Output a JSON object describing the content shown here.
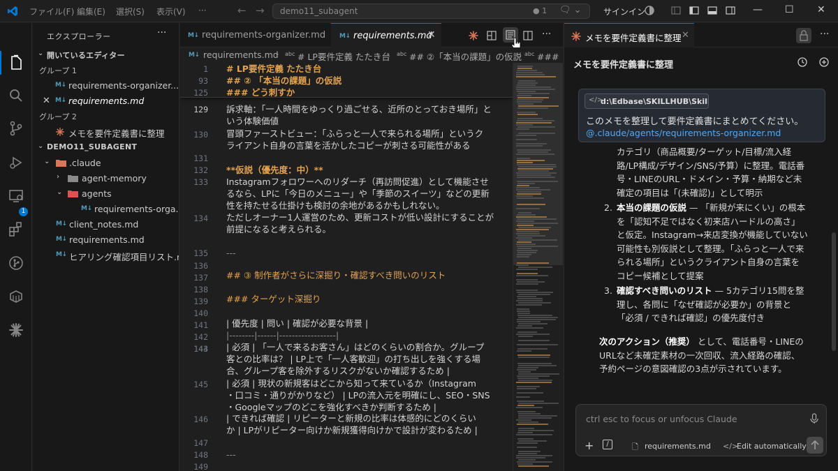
{
  "titlebar": {
    "menus": [
      "ファイル(F)",
      "編集(E)",
      "選択(S)",
      "表示(V)",
      "···"
    ],
    "search_text": "demo11_subagent",
    "notification_count": "1",
    "signin_label": "サインイン"
  },
  "activitybar": {
    "extensions_badge": "1"
  },
  "explorer": {
    "title": "エクスプローラー",
    "more": "···",
    "open_editors_label": "開いているエディター",
    "group1_label": "グループ 1",
    "group1_items": [
      "requirements-organizer....",
      "requirements.md"
    ],
    "group2_label": "グループ 2",
    "group2_items": [
      "メモを要件定義書に整理"
    ],
    "workspace_label": "DEMO11_SUBAGENT",
    "tree": {
      "claude_folder": ".claude",
      "agent_memory": "agent-memory",
      "agents": "agents",
      "agents_file": "requirements-orga...",
      "files": [
        "client_notes.md",
        "requirements.md",
        "ヒアリング確認項目リスト.md"
      ]
    }
  },
  "editor": {
    "tabs": [
      {
        "label": "requirements-organizer.md",
        "active": false
      },
      {
        "label": "requirements.md",
        "active": true
      }
    ],
    "close_glyph": "✕",
    "breadcrumb": [
      "requirements.md",
      "# LP要件定義 たたき台",
      "## ②「本当の課題」の仮説",
      "### ど"
    ],
    "sticky": [
      {
        "ln": "1",
        "text": "# LP要件定義 たたき台"
      },
      {
        "ln": "93",
        "text": "## ② 「本当の課題」の仮説"
      },
      {
        "ln": "125",
        "text": "### どう刺すか"
      }
    ],
    "lines": [
      {
        "ln": "129",
        "text": "訴求軸：「一人時間をゆっくり過ごせる、近所のとっておき場所」と"
      },
      {
        "ln": "",
        "text": "いう体験価値"
      },
      {
        "ln": "130",
        "text": "冒頭ファーストビュー：「ふらっと一人で来られる場所」というク"
      },
      {
        "ln": "",
        "text": "ライアント自身の言葉を活かしたコピーが刺さる可能性がある"
      },
      {
        "ln": "131",
        "text": ""
      },
      {
        "ln": "132",
        "text": "**仮説（優先度：中）**"
      },
      {
        "ln": "133",
        "text": "Instagramフォロワーへのリダーチ（再訪問促進）として機能させ"
      },
      {
        "ln": "",
        "text": "るなら、LPに「今日のメニュー」や「季節のスイーツ」などの更新"
      },
      {
        "ln": "",
        "text": "性を持たせる仕掛けも検討の余地があるかもしれない。"
      },
      {
        "ln": "134",
        "text": "ただしオーナー1人運営のため、更新コストが低い設計にすることが"
      },
      {
        "ln": "",
        "text": "前提になると考えられる。"
      },
      {
        "ln": "135",
        "text": ""
      },
      {
        "ln": "136",
        "text": "---"
      },
      {
        "ln": "137",
        "text": ""
      },
      {
        "ln": "138",
        "text": "## ③ 制作者がさらに深掘り・確認すべき問いのリスト"
      },
      {
        "ln": "139",
        "text": ""
      },
      {
        "ln": "140",
        "text": "### ターゲット深掘り"
      },
      {
        "ln": "141",
        "text": ""
      },
      {
        "ln": "142",
        "text": "| 優先度 | 問い | 確認が必要な背景 |"
      },
      {
        "ln": "143",
        "text": "|--------|------|------------------|"
      },
      {
        "ln": "144",
        "text": "| 必須 | 「一人で来るお客さん」はどのくらいの割合か。グループ"
      },
      {
        "ln": "",
        "text": "客との比率は？ | LP上で「一人客歓迎」の打ち出しを強くする場"
      },
      {
        "ln": "",
        "text": "合、グループ客を除外するリスクがないか確認するため |"
      },
      {
        "ln": "145",
        "text": "| 必須 | 現状の新規客はどこから知って来ているか（Instagram"
      },
      {
        "ln": "",
        "text": "・口コミ・通りがかりなど） | LPの流入元を明確にし、SEO・SNS"
      },
      {
        "ln": "",
        "text": "・Googleマップのどこを強化すべきか判断するため |"
      },
      {
        "ln": "146",
        "text": "| できれば確認 | リピーターと新規の比率は体感的にどのくらい"
      },
      {
        "ln": "",
        "text": "か | LPがリピーター向けか新規獲得向けかで設計が変わるため |"
      },
      {
        "ln": "147",
        "text": ""
      },
      {
        "ln": "148",
        "text": "---"
      },
      {
        "ln": "149",
        "text": ""
      }
    ]
  },
  "claude": {
    "tab_label": "メモを要件定義書に整理",
    "header_title": "メモを要件定義書に整理",
    "user_message": {
      "file_chip": "d:\\Edbase\\SKILLHUB\\Skillhu...",
      "text": "このメモを整理して要件定義書にまとめてください。",
      "mention": "@.claude/agents/requirements-organizer.md"
    },
    "response": {
      "item1_lines": [
        "カテゴリ（商品概要/ターゲット/目標/流入経",
        "路/LP構成/デザイン/SNS/予算）に整理。電話番",
        "号・LINEのURL・ドメイン・予算・納期など未",
        "確定の項目は「(未確認)」として明示"
      ],
      "item2_num": "2.",
      "item2_title": "本当の課題の仮説",
      "item2_lines": [
        " — 「新規が来にくい」の根本",
        "を「認知不足ではなく初来店ハードルの高さ」",
        "と仮定。Instagram→来店変換が機能していない",
        "可能性も別仮説として整理。「ふらっと一人で来",
        "られる場所」というクライアント自身の言葉を",
        "コピー候補として提案"
      ],
      "item3_num": "3.",
      "item3_title": "確認すべき問いのリスト",
      "item3_lines": [
        " — 5カテゴリ15問を整",
        "理し、各問に「なぜ確認が必要か」の背景と",
        "「必須 / できれば確認」の優先度付き"
      ],
      "next_title": "次のアクション（推奨）",
      "next_lines": [
        " として、電話番号・LINEの",
        "URLなど未確定素材の一次回収、流入経路の確認、",
        "予約ページの意図確認の3点が示されています。"
      ]
    },
    "input": {
      "placeholder": "ctrl esc to focus or unfocus Claude",
      "file_label": "requirements.md",
      "mode_label": "Edit automatically"
    }
  }
}
